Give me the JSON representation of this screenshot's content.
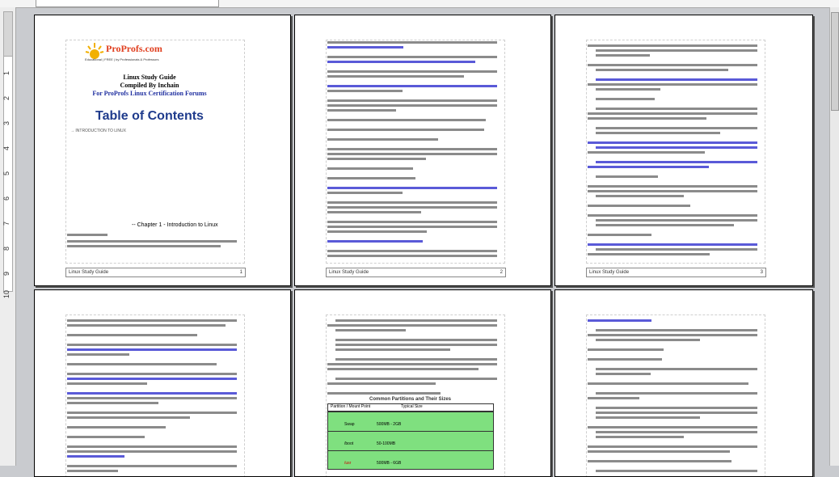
{
  "app": {
    "name": "Document viewer"
  },
  "ruler": {
    "vertical_numbers": [
      "1",
      "2",
      "3",
      "4",
      "5",
      "6",
      "7",
      "8",
      "9",
      "10"
    ]
  },
  "pages": [
    {
      "id": "p1",
      "logo": {
        "brand": "ProProfs.com",
        "tagline": "Educational | FREE | by Professionals & Professors"
      },
      "title_lines": [
        "Linux Study Guide",
        "Compiled By Inchain",
        "For ProProfs Linux Certification Forums"
      ],
      "toc_title": "Table of Contents",
      "toc_entry": "→ INTRODUCTION TO LINUX",
      "chapter": "-- Chapter 1 - Introduction to Linux",
      "footer": "Linux Study Guide",
      "footer_page": "1"
    },
    {
      "id": "p2",
      "footer": "Linux Study Guide",
      "footer_page": "2"
    },
    {
      "id": "p3",
      "footer": "Linux Study Guide",
      "footer_page": "3"
    },
    {
      "id": "p4"
    },
    {
      "id": "p5",
      "table": {
        "title": "Common Partitions and Their Sizes",
        "header": [
          "Partition / Mount Point",
          "Typical Size"
        ],
        "rows": [
          {
            "name": "Swap",
            "size": "500MB - 2GB"
          },
          {
            "name": "/boot",
            "size": "50-100MB"
          },
          {
            "name": "/usr",
            "size": "500MB - 6GB"
          }
        ]
      }
    },
    {
      "id": "p6"
    }
  ]
}
